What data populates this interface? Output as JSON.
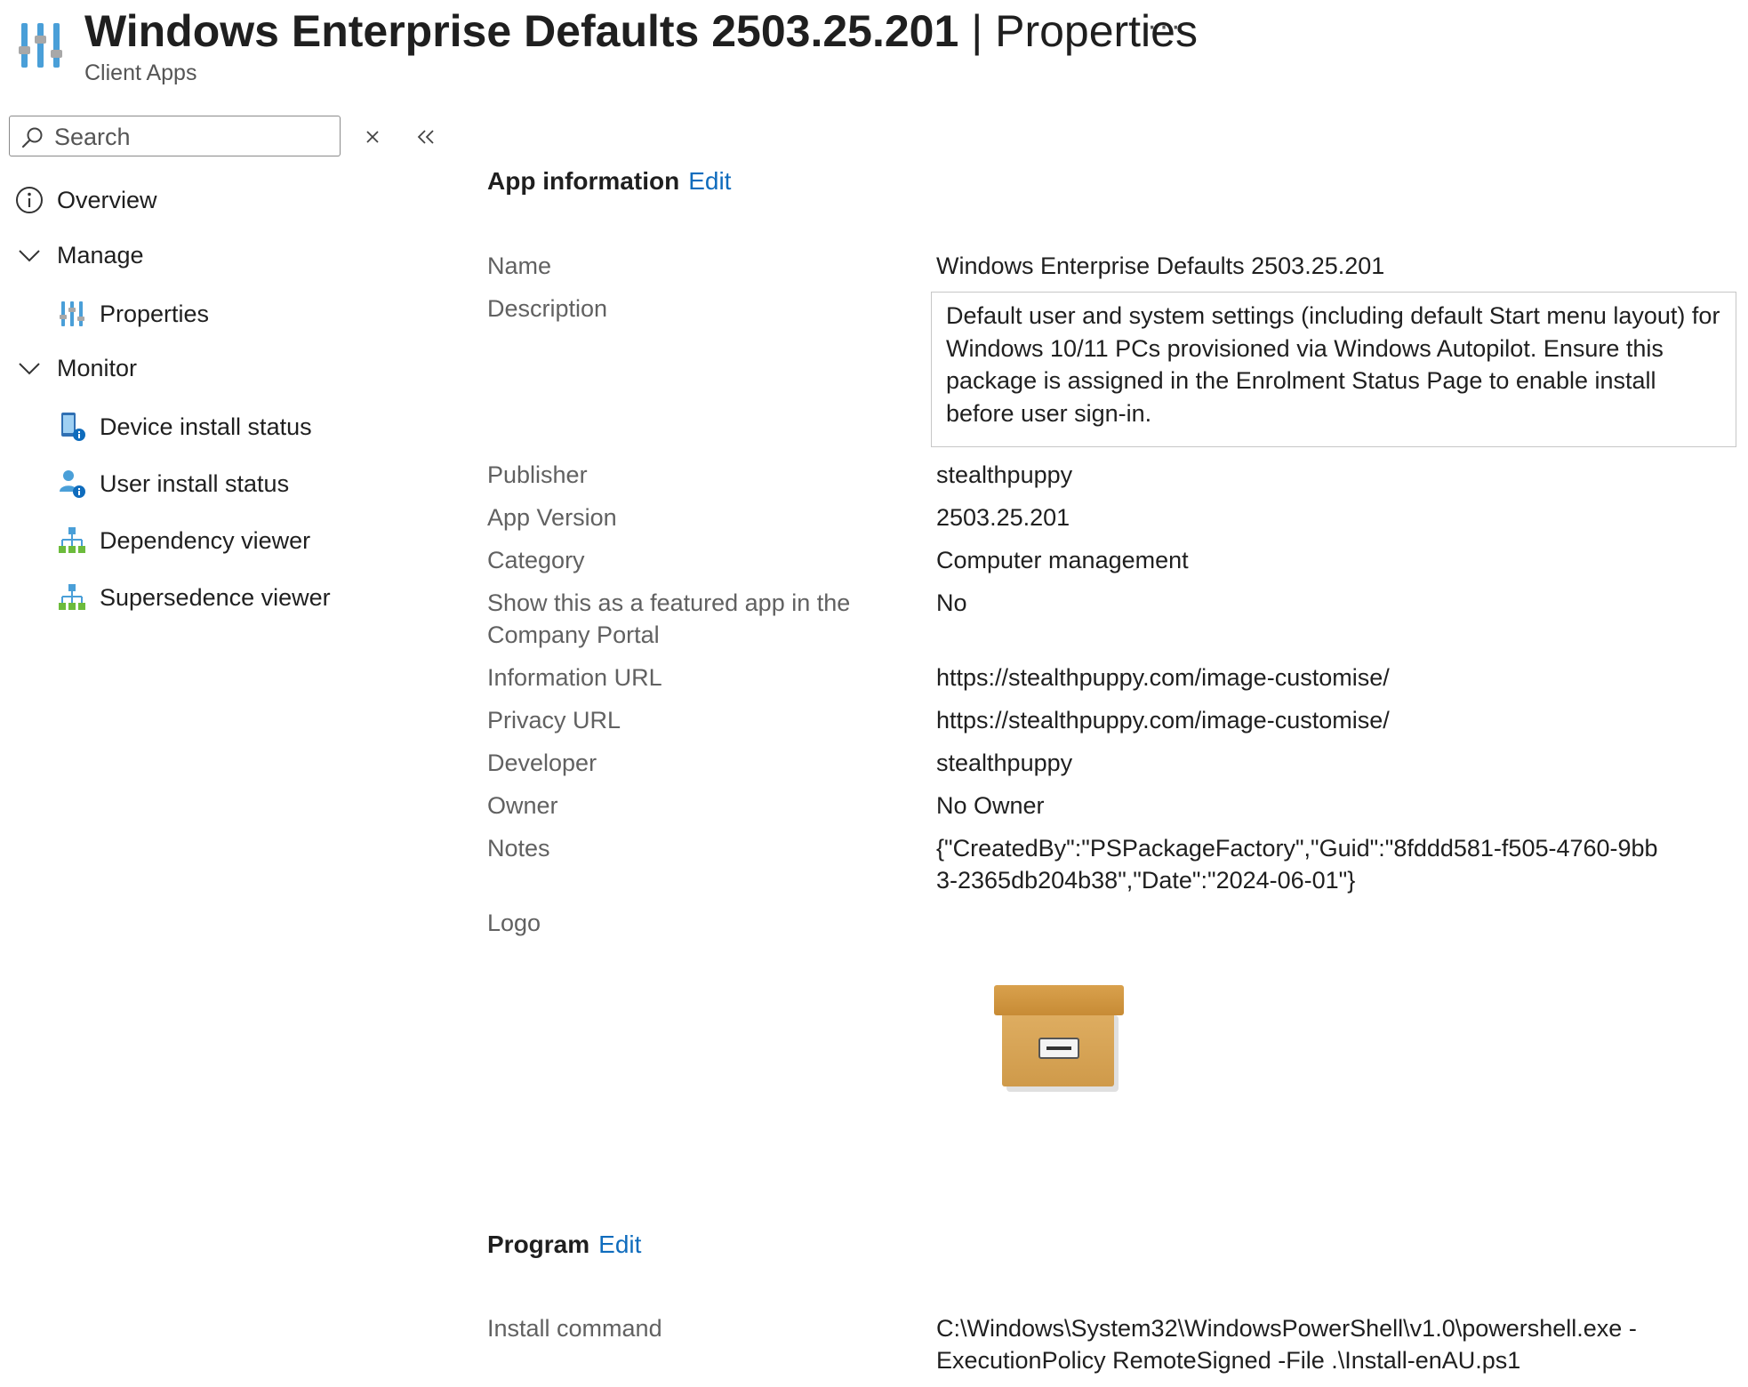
{
  "header": {
    "title_bold": "Windows Enterprise Defaults 2503.25.201",
    "separator": "|",
    "title_page": "Properties",
    "more_label": "···",
    "subtitle": "Client Apps",
    "icon": "properties-sliders-icon"
  },
  "sidebar": {
    "search_placeholder": "Search",
    "clear_icon": "close-icon",
    "collapse_icon": "double-chevron-left-icon",
    "items": [
      {
        "label": "Overview",
        "icon": "info-circle-icon"
      },
      {
        "label": "Manage",
        "icon": "chevron-down-icon"
      },
      {
        "label": "Properties",
        "icon": "properties-sliders-icon"
      },
      {
        "label": "Monitor",
        "icon": "chevron-down-icon"
      },
      {
        "label": "Device install status",
        "icon": "device-info-icon"
      },
      {
        "label": "User install status",
        "icon": "user-info-icon"
      },
      {
        "label": "Dependency viewer",
        "icon": "hierarchy-icon"
      },
      {
        "label": "Supersedence viewer",
        "icon": "hierarchy-icon"
      }
    ]
  },
  "app_info": {
    "title": "App information",
    "edit_label": "Edit",
    "rows": {
      "name": {
        "label": "Name",
        "value": "Windows Enterprise Defaults 2503.25.201"
      },
      "description": {
        "label": "Description",
        "value": "Default user and system settings (including default Start menu layout) for Windows 10/11 PCs provisioned via Windows Autopilot. Ensure this package is assigned in the Enrolment Status Page to enable install before user sign-in."
      },
      "publisher": {
        "label": "Publisher",
        "value": "stealthpuppy"
      },
      "app_version": {
        "label": "App Version",
        "value": "2503.25.201"
      },
      "category": {
        "label": "Category",
        "value": "Computer management"
      },
      "featured": {
        "label": "Show this as a featured app in the Company Portal",
        "value": "No"
      },
      "information_url": {
        "label": "Information URL",
        "value": "https://stealthpuppy.com/image-customise/"
      },
      "privacy_url": {
        "label": "Privacy URL",
        "value": "https://stealthpuppy.com/image-customise/"
      },
      "developer": {
        "label": "Developer",
        "value": "stealthpuppy"
      },
      "owner": {
        "label": "Owner",
        "value": "No Owner"
      },
      "notes": {
        "label": "Notes",
        "value": "{\"CreatedBy\":\"PSPackageFactory\",\"Guid\":\"8fddd581-f505-4760-9bb3-2365db204b38\",\"Date\":\"2024-06-01\"}"
      },
      "logo": {
        "label": "Logo",
        "icon": "archive-box-icon"
      }
    }
  },
  "program": {
    "title": "Program",
    "edit_label": "Edit",
    "rows": {
      "install_command": {
        "label": "Install command",
        "value": "C:\\Windows\\System32\\WindowsPowerShell\\v1.0\\powershell.exe -ExecutionPolicy RemoteSigned -File .\\Install-enAU.ps1"
      }
    }
  },
  "colors": {
    "accent_link": "#0f6cbd",
    "label_gray": "#616161",
    "text": "#1f1f1f",
    "logo_box": "#d9a04e"
  }
}
